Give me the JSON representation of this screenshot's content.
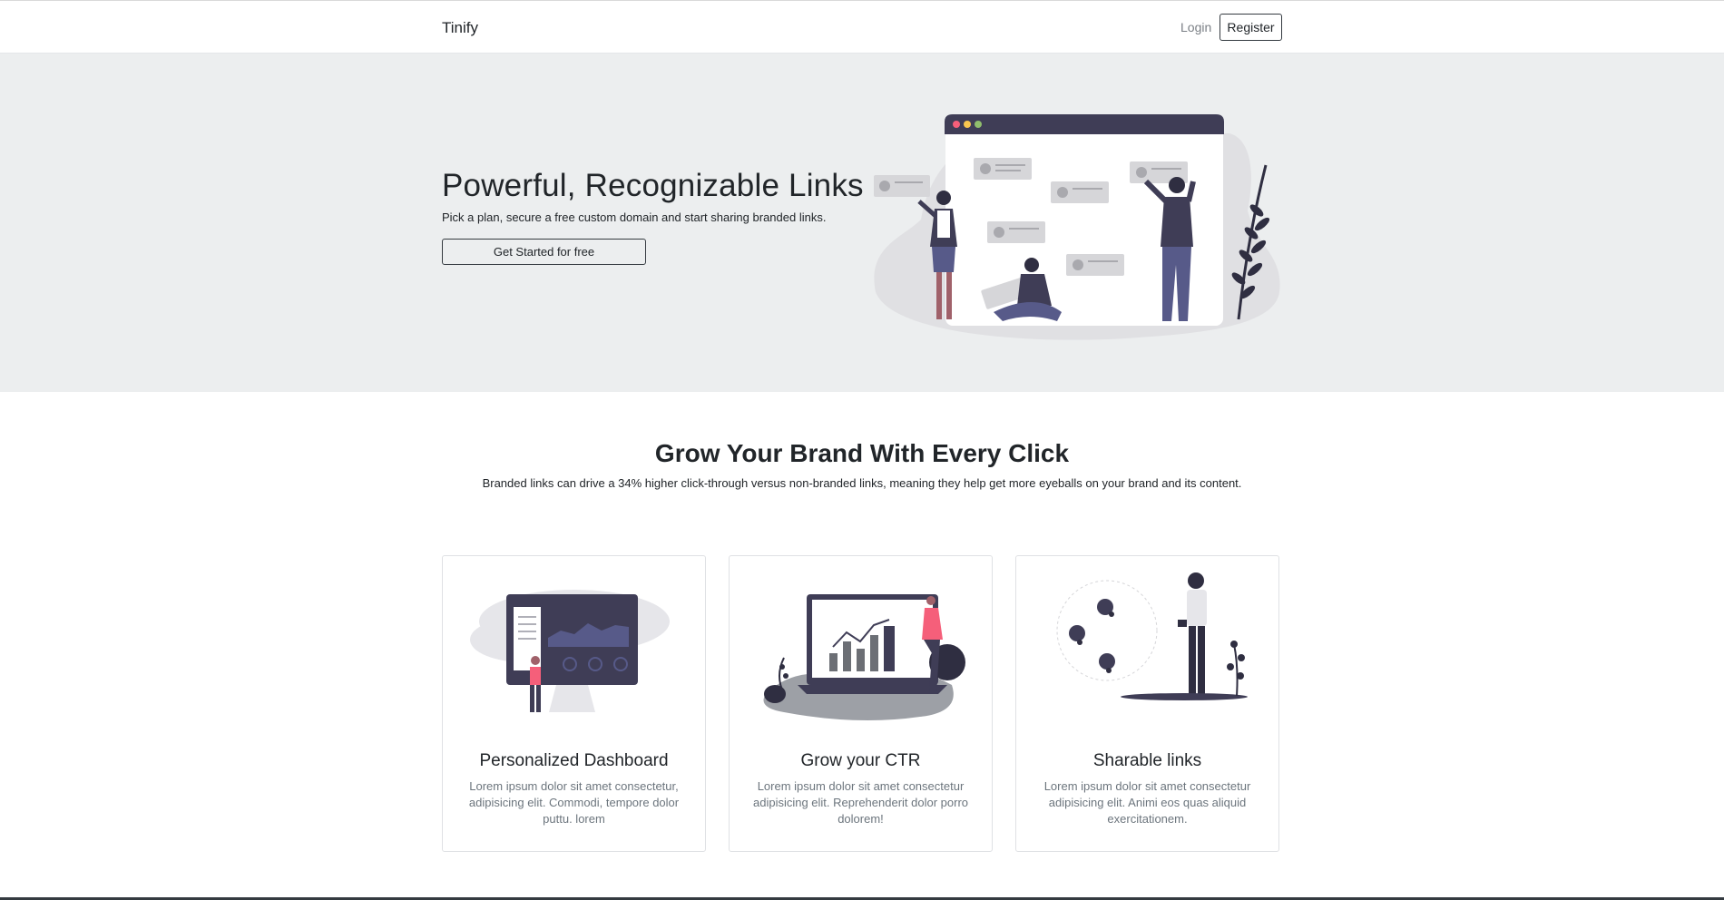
{
  "navbar": {
    "brand": "Tinify",
    "login": "Login",
    "register": "Register"
  },
  "hero": {
    "title": "Powerful, Recognizable Links",
    "subtitle": "Pick a plan, secure a free custom domain and start sharing branded links.",
    "cta": "Get Started for free"
  },
  "features": {
    "title": "Grow Your Brand With Every Click",
    "subtitle": "Branded links can drive a 34% higher click-through versus non-branded links, meaning they help get more eyeballs on your brand and its content.",
    "cards": [
      {
        "title": "Personalized Dashboard",
        "text": "Lorem ipsum dolor sit amet consectetur, adipisicing elit. Commodi, tempore dolor puttu. lorem"
      },
      {
        "title": "Grow your CTR",
        "text": "Lorem ipsum dolor sit amet consectetur adipisicing elit. Reprehenderit dolor porro dolorem!"
      },
      {
        "title": "Sharable links",
        "text": "Lorem ipsum dolor sit amet consectetur adipisicing elit. Animi eos quas aliquid exercitationem."
      }
    ]
  },
  "colors": {
    "hero_bg": "#eceeef",
    "dark": "#3f3d56",
    "accent": "#f55f7a",
    "border": "#343a40"
  }
}
